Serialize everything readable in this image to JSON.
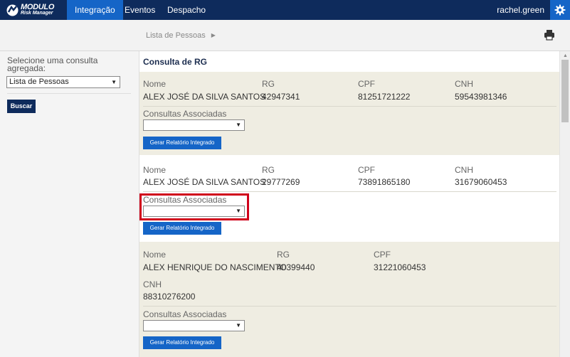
{
  "brand": {
    "name": "MODULO",
    "subtitle": "Risk Manager"
  },
  "nav": {
    "items": [
      "Integração",
      "Eventos",
      "Despacho"
    ],
    "active": "Integração"
  },
  "user": {
    "name": "rachel.green"
  },
  "breadcrumb": {
    "current": "Lista de Pessoas"
  },
  "left_panel": {
    "label": "Selecione uma consulta agregada:",
    "selected": "Lista de Pessoas",
    "button": "Buscar"
  },
  "main": {
    "title": "Consulta de RG",
    "labels": {
      "nome": "Nome",
      "rg": "RG",
      "cpf": "CPF",
      "cnh": "CNH",
      "consultas": "Consultas Associadas",
      "gerar": "Gerar Relatório Integrado"
    },
    "records": [
      {
        "nome": "ALEX JOSÉ DA SILVA SANTOS",
        "rg": "42947341",
        "cpf": "81251721222",
        "cnh": "59543981346",
        "consulta_selected": ""
      },
      {
        "nome": "ALEX JOSÉ DA SILVA SANTOS",
        "rg": "29777269",
        "cpf": "73891865180",
        "cnh": "31679060453",
        "consulta_selected": ""
      },
      {
        "nome": "ALEX HENRIQUE DO NASCIMENTO",
        "rg": "40399440",
        "cpf": "31221060453",
        "cnh": "88310276200",
        "consulta_selected": ""
      }
    ]
  },
  "colors": {
    "topbar": "#0e2b5c",
    "accent": "#1565c7",
    "record_alt": "#efede2",
    "highlight": "#d0021b"
  }
}
